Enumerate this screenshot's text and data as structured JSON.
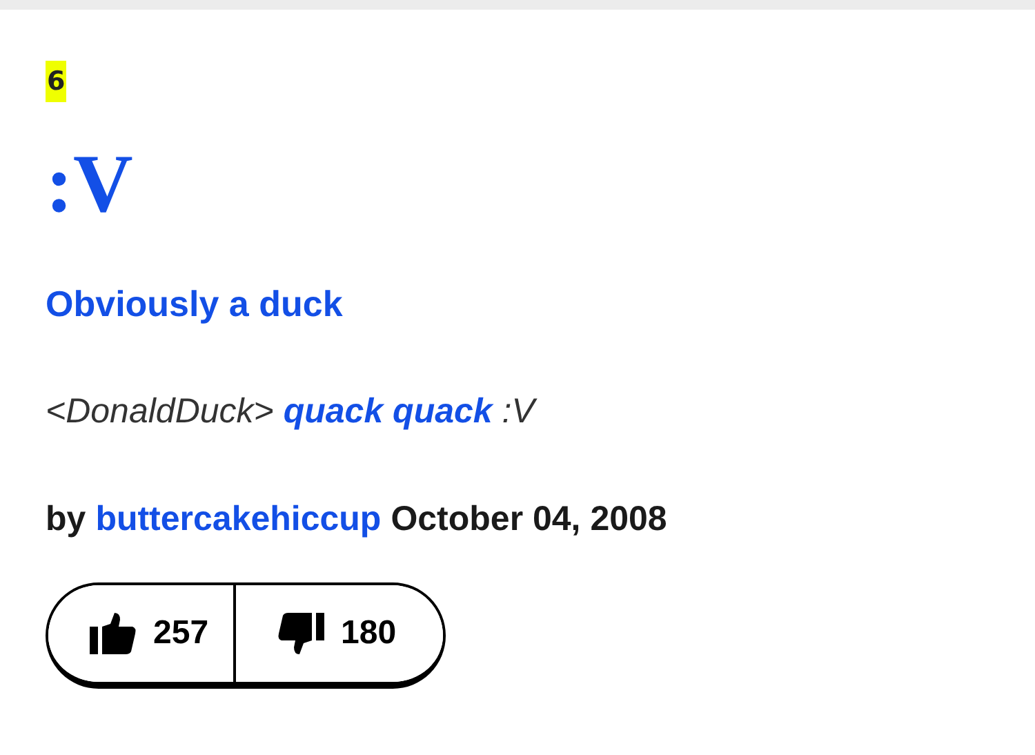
{
  "definition": {
    "rank": "6",
    "word": ":V",
    "meaning": "Obviously a duck",
    "example": [
      {
        "kind": "text",
        "text": "<DonaldDuck>"
      },
      {
        "kind": "link",
        "text": "quack quack"
      },
      {
        "kind": "text",
        "text": ":V"
      }
    ],
    "byline": {
      "by": "by",
      "author": "buttercakehiccup",
      "date": "October 04, 2008"
    },
    "votes": {
      "up": "257",
      "down": "180"
    }
  }
}
